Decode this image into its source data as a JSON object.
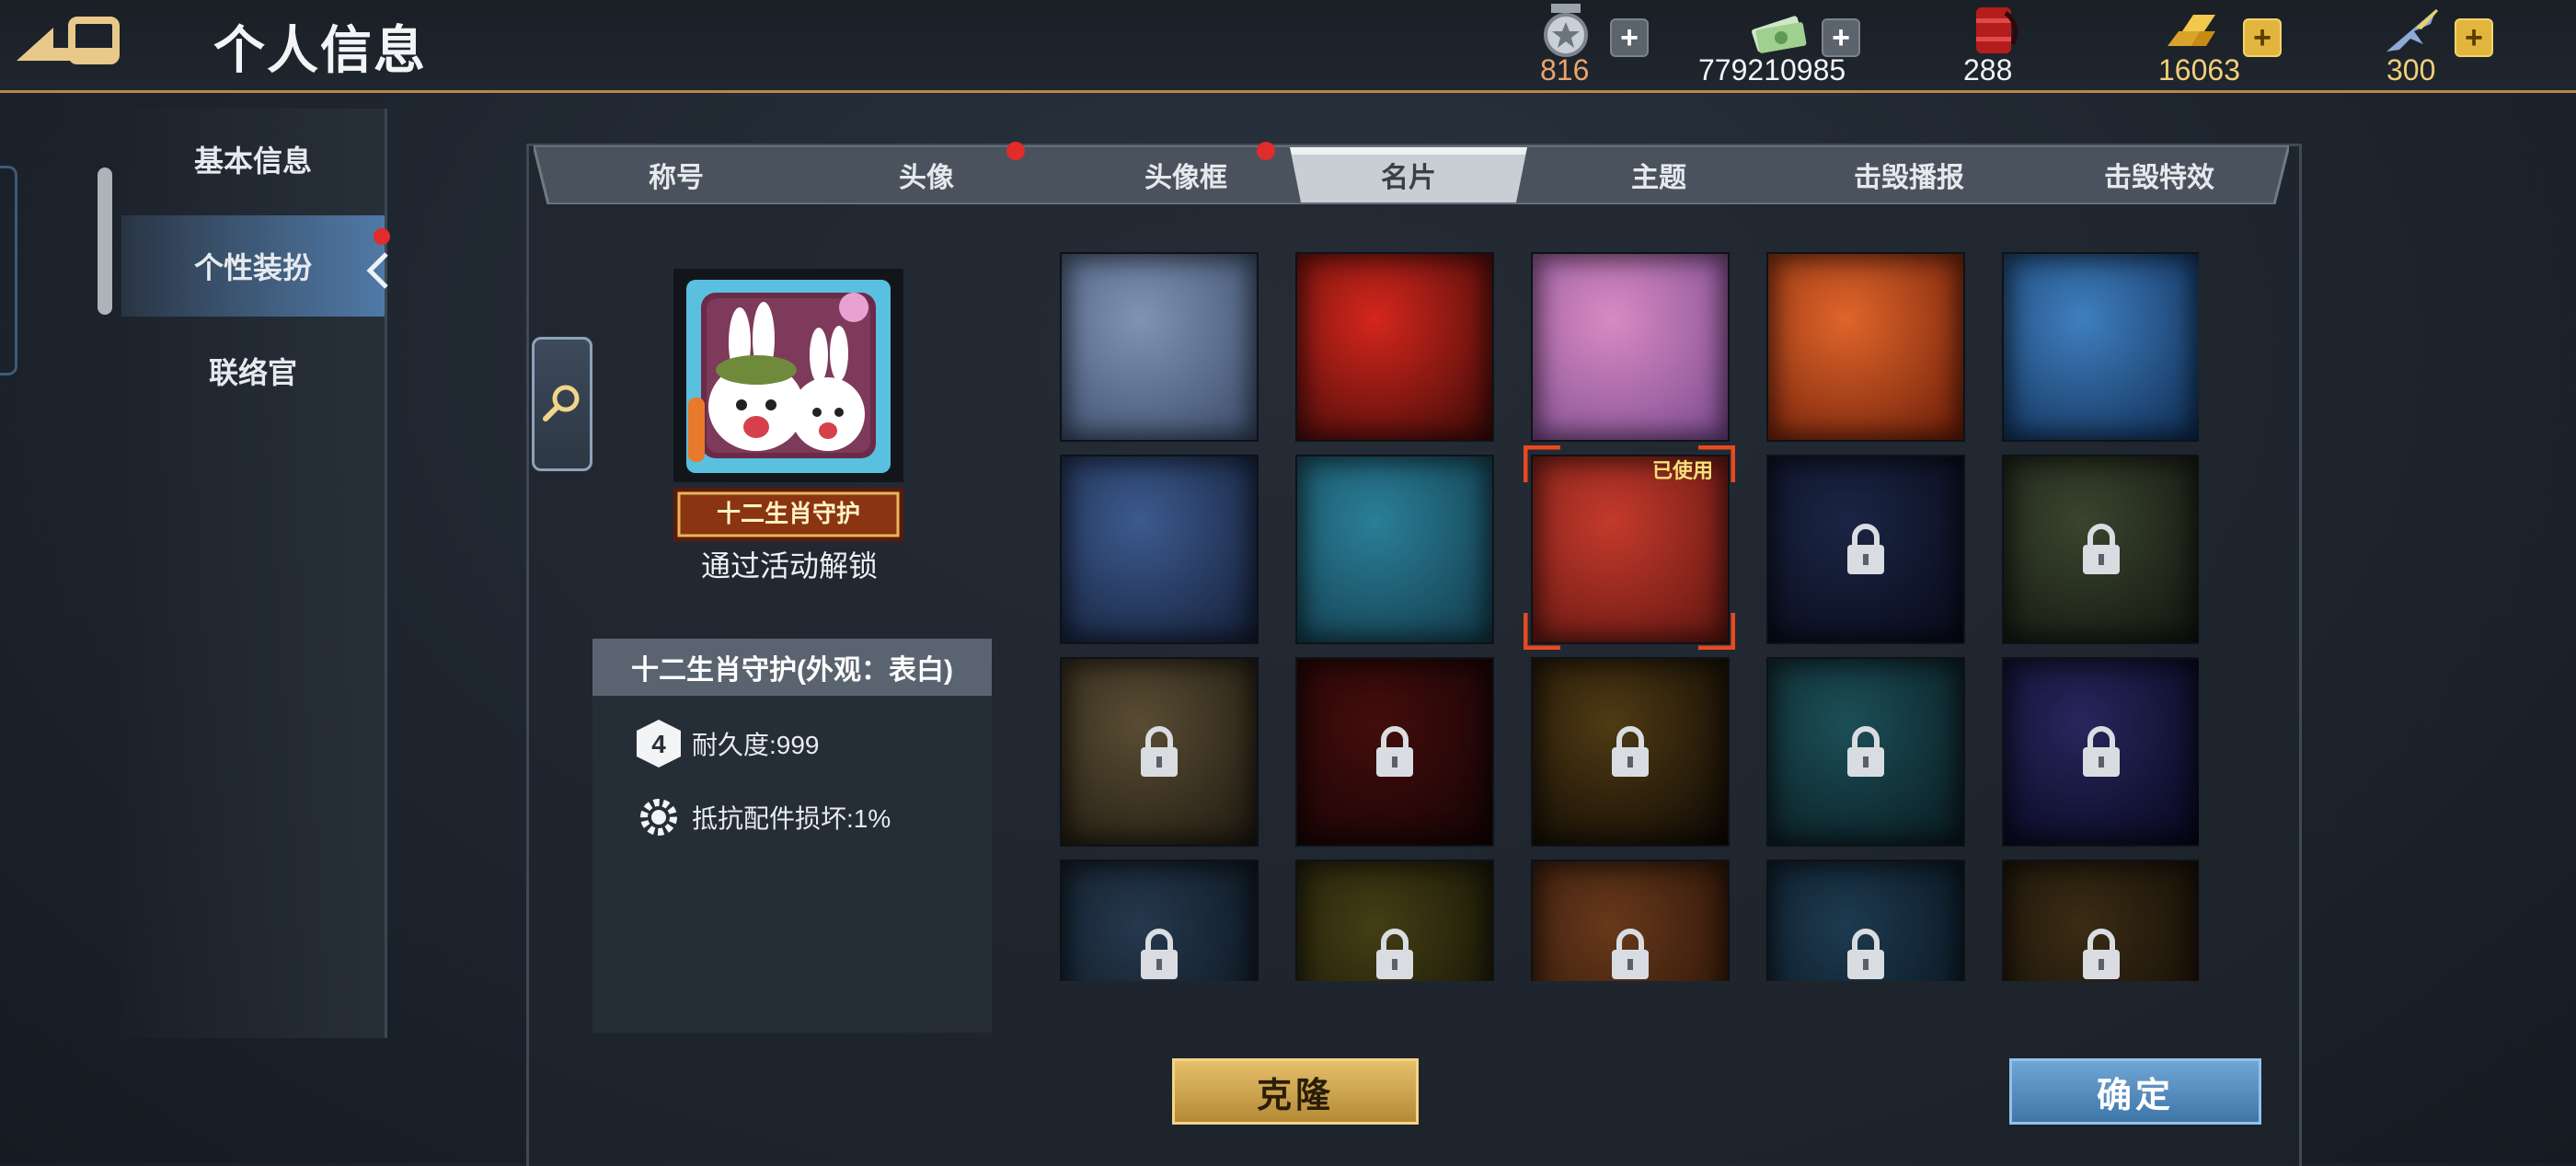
{
  "header": {
    "title": "个人信息"
  },
  "resources": [
    {
      "icon": "medal-icon",
      "value": "816",
      "color": "#e9a46a",
      "plus": "+"
    },
    {
      "icon": "cash-icon",
      "value": "779210985",
      "color": "#f2f4f6",
      "plus": "+"
    },
    {
      "icon": "oil-barrel-icon",
      "value": "288",
      "color": "#f2f4f6"
    },
    {
      "icon": "gold-bars-icon",
      "value": "16063",
      "color": "#f2cf7a",
      "plus": "+"
    },
    {
      "icon": "jet-icon",
      "value": "300",
      "color": "#f2cf7a",
      "plus": "+"
    }
  ],
  "sidebar": {
    "items": [
      {
        "label": "基本信息",
        "active": false
      },
      {
        "label": "个性装扮",
        "active": true,
        "notice": true
      },
      {
        "label": "联络官",
        "active": false
      }
    ]
  },
  "tabs": [
    {
      "label": "称号"
    },
    {
      "label": "头像",
      "notice": true
    },
    {
      "label": "头像框",
      "notice": true
    },
    {
      "label": "名片",
      "active": true
    },
    {
      "label": "主题"
    },
    {
      "label": "击毁播报"
    },
    {
      "label": "击毁特效"
    }
  ],
  "preview": {
    "banner_text": "十二生肖守护",
    "unlock_text": "通过活动解锁",
    "item_name": "十二生肖守护(外观：表白)",
    "stats": [
      {
        "icon": "durability-icon",
        "text": "耐久度:999"
      },
      {
        "icon": "gear-icon",
        "text": "抵抗配件损坏:1%"
      }
    ]
  },
  "cards": [
    {
      "name": "card-blue-lattice",
      "locked": false,
      "colors": [
        "#7f93b4",
        "#3a4a68"
      ]
    },
    {
      "name": "card-red-flag",
      "locked": false,
      "colors": [
        "#d4261c",
        "#3a0a08"
      ]
    },
    {
      "name": "card-pink-hearts",
      "locked": false,
      "colors": [
        "#d88ac2",
        "#7a4a90"
      ]
    },
    {
      "name": "card-orange-flames",
      "locked": false,
      "colors": [
        "#e0652a",
        "#6a1c08"
      ]
    },
    {
      "name": "card-blue-hexagons",
      "locked": false,
      "colors": [
        "#3f7fbf",
        "#0e2a50"
      ]
    },
    {
      "name": "card-navy-stripes",
      "locked": false,
      "colors": [
        "#3c5a8e",
        "#141e36"
      ]
    },
    {
      "name": "card-teal-waves",
      "locked": false,
      "colors": [
        "#2a7f98",
        "#123848"
      ]
    },
    {
      "name": "card-red-clouds",
      "locked": false,
      "used": true,
      "colors": [
        "#c43a2c",
        "#5e1510"
      ]
    },
    {
      "name": "card-star-navy",
      "locked": true,
      "colors": [
        "#2a3a6a",
        "#0c1026"
      ]
    },
    {
      "name": "card-green-camo",
      "locked": true,
      "colors": [
        "#5a6a48",
        "#1a2016"
      ]
    },
    {
      "name": "card-tan-diamonds",
      "locked": true,
      "colors": [
        "#8a7650",
        "#2e2618"
      ]
    },
    {
      "name": "card-dark-red",
      "locked": true,
      "colors": [
        "#6a1414",
        "#1e0606"
      ]
    },
    {
      "name": "card-brown-dusk",
      "locked": true,
      "colors": [
        "#7a5a1e",
        "#140c06"
      ]
    },
    {
      "name": "card-teal-ocean",
      "locked": true,
      "colors": [
        "#2c7a86",
        "#0e2630"
      ]
    },
    {
      "name": "card-purple-night",
      "locked": true,
      "colors": [
        "#3c3c90",
        "#0a0a2a"
      ]
    },
    {
      "name": "card-helicopter",
      "locked": true,
      "colors": [
        "#3a5878",
        "#101c2a"
      ]
    },
    {
      "name": "card-gold-floral",
      "locked": true,
      "colors": [
        "#6a6020",
        "#1a1a08"
      ]
    },
    {
      "name": "card-autumn-leaves",
      "locked": true,
      "colors": [
        "#a0582a",
        "#3a1a0a"
      ]
    },
    {
      "name": "card-snowflakes",
      "locked": true,
      "colors": [
        "#2e5a7a",
        "#0c1c2c"
      ]
    },
    {
      "name": "card-bronze-star",
      "locked": true,
      "colors": [
        "#5a4420",
        "#181008"
      ]
    }
  ],
  "used_label": "已使用",
  "buttons": {
    "clone": "克隆",
    "confirm": "确定"
  }
}
